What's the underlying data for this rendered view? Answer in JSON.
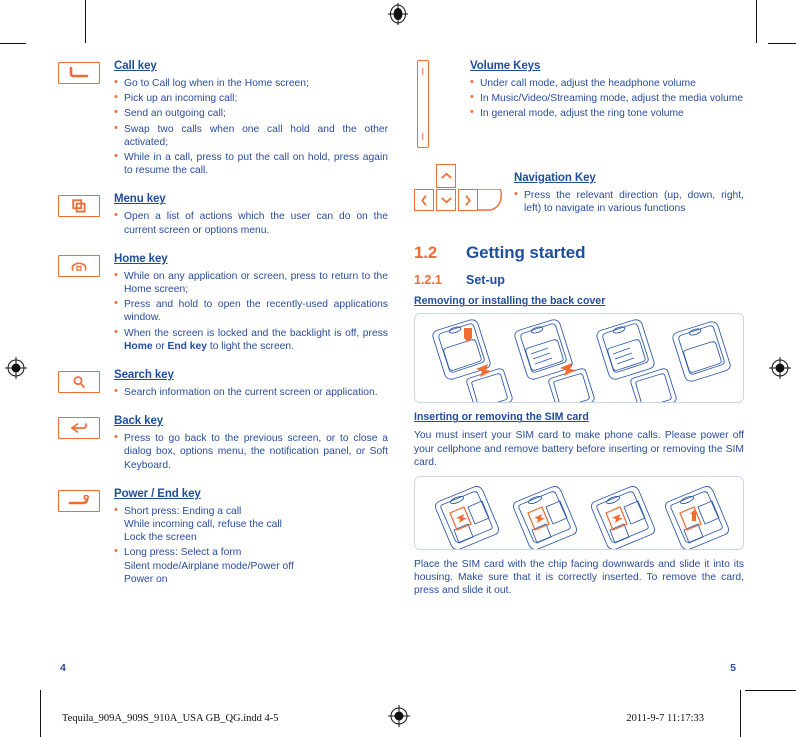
{
  "document": {
    "footer_filename": "Tequila_909A_909S_910A_USA GB_QG.indd   4-5",
    "footer_timestamp": "2011-9-7   11:17:33",
    "folio_left": "4",
    "folio_right": "5"
  },
  "colors": {
    "heading_blue": "#1f4e9c",
    "body_blue": "#2a4d9b",
    "accent_orange": "#ef6c33",
    "figure_border": "#c9d6ea"
  },
  "left_page": {
    "keys": [
      {
        "icon": "call-key-icon",
        "title": "Call key",
        "bullets": [
          "Go to Call log when in the Home screen;",
          "Pick up an incoming call;",
          "Send an outgoing call;",
          "Swap two calls when one call hold and the other activated;",
          "While in a call, press to put the call on hold, press again to resume the call."
        ]
      },
      {
        "icon": "menu-key-icon",
        "title": "Menu key",
        "bullets": [
          "Open a list of actions which the user can do on the current screen or options menu."
        ]
      },
      {
        "icon": "home-key-icon",
        "title": "Home key",
        "bullets": [
          "While on any application or screen,  press to return to the Home screen;",
          "Press and hold to open the recently-used applications window."
        ],
        "rich_bullet": {
          "prefix": "When the screen is locked and the backlight is off, press ",
          "bold1": "Home",
          "middle": " or ",
          "bold2": "End key",
          "suffix": " to light the screen."
        }
      },
      {
        "icon": "search-key-icon",
        "title": "Search key",
        "bullets": [
          "Search information on the current screen or application."
        ]
      },
      {
        "icon": "back-key-icon",
        "title": "Back key",
        "bullets": [
          "Press to go back to the previous screen, or to close a dialog box, options menu, the notification panel, or Soft Keyboard."
        ]
      },
      {
        "icon": "power-end-key-icon",
        "title": "Power / End key",
        "groups": [
          {
            "lead": "Short press: Ending a call",
            "lines": [
              "While incoming call, refuse the call",
              "Lock the screen"
            ]
          },
          {
            "lead": "Long press: Select a form",
            "lines": [
              "Silent mode/Airplane mode/Power off",
              "Power on"
            ]
          }
        ]
      }
    ]
  },
  "right_page": {
    "volume_key": {
      "icon": "volume-key-icon",
      "title": "Volume Keys ",
      "bullets": [
        "Under call mode, adjust the headphone volume",
        "In  Music/Video/Streaming  mode,  adjust  the  media volume",
        "In general mode, adjust the ring tone volume"
      ]
    },
    "navigation_key": {
      "icon": "navigation-key-icon",
      "title": "Navigation Key",
      "bullets": [
        "Press the relevant direction (up, down, right, left) to navigate in various functions"
      ]
    },
    "section": {
      "number": "1.2",
      "title": "Getting started",
      "sub_number": "1.2.1",
      "sub_title": "Set-up"
    },
    "back_cover": {
      "heading": "Removing or installing the back cover",
      "figure_name": "back-cover-steps-figure"
    },
    "sim_card": {
      "heading": "Inserting or removing the SIM card",
      "paragraph_before": "You must insert your SIM card to make phone calls. Please power off your cellphone and remove battery before inserting or removing the SIM card.",
      "figure_name": "sim-card-steps-figure",
      "paragraph_after": "Place the SIM card with the chip facing downwards and slide it into its housing. Make sure that it is correctly inserted. To remove the card, press and slide it out."
    }
  }
}
